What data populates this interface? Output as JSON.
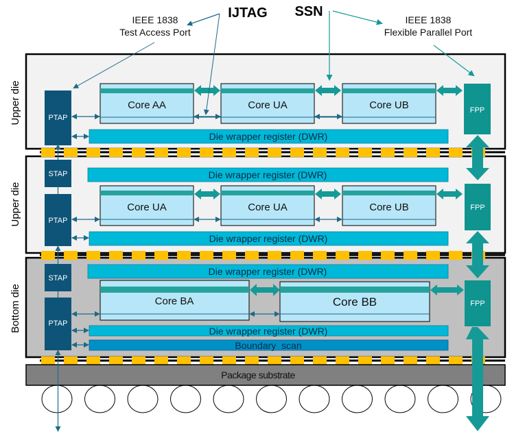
{
  "annotations": {
    "ijtag": "IJTAG",
    "ssn": "SSN",
    "tap_line1": "IEEE 1838",
    "tap_line2": "Test Access Port",
    "fpp_line1": "IEEE 1838",
    "fpp_line2": "Flexible Parallel Port"
  },
  "dies": [
    {
      "label": "Upper die",
      "background": "#f2f2f2",
      "stap": null,
      "ptap": "PTAP",
      "fpp": "FPP",
      "dwr_top": null,
      "cores": [
        "Core AA",
        "Core UA",
        "Core UB"
      ],
      "dwr_bottom": "Die wrapper register (DWR)",
      "boundary_scan": null
    },
    {
      "label": "Upper die",
      "background": "#f2f2f2",
      "stap": "STAP",
      "ptap": "PTAP",
      "fpp": "FPP",
      "dwr_top": "Die wrapper register (DWR)",
      "cores": [
        "Core UA",
        "Core UA",
        "Core UB"
      ],
      "dwr_bottom": "Die wrapper register (DWR)",
      "boundary_scan": null
    },
    {
      "label": "Bottom die",
      "background": "#c0c0c0",
      "stap": "STAP",
      "ptap": "PTAP",
      "fpp": "FPP",
      "dwr_top": "Die wrapper register (DWR)",
      "cores": [
        "Core BA",
        "Core BB"
      ],
      "dwr_bottom": "Die wrapper register (DWR)",
      "boundary_scan": "Boundary  scan"
    }
  ],
  "package": {
    "label": "Package substrate"
  },
  "solder_ball_count": 11,
  "colors": {
    "tap_block": "#0d5478",
    "fpp_block": "#0f9490",
    "core_fill": "#b7e6f8",
    "core_bar": "#25a29c",
    "dwr": "#00b8d8",
    "boundary_scan": "#0090c8",
    "bump": "#ffc000",
    "substrate": "#808080",
    "ijtag_arrow": "#1d6a88",
    "ssn_arrow": "#159a97"
  }
}
